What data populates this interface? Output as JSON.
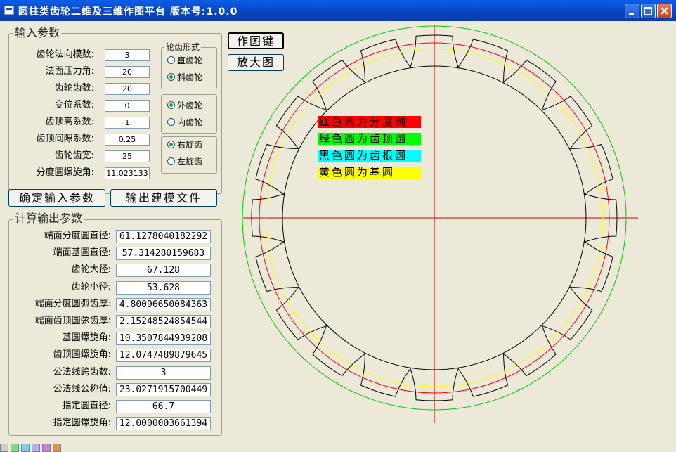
{
  "window": {
    "title": "圆柱类齿轮二维及三维作图平台 版本号:1.0.0"
  },
  "input_group": {
    "title": "输入参数",
    "fields": [
      {
        "label": "齿轮法向模数:",
        "value": "3"
      },
      {
        "label": "法面压力角:",
        "value": "20"
      },
      {
        "label": "齿轮齿数:",
        "value": "20"
      },
      {
        "label": "变位系数:",
        "value": "0"
      },
      {
        "label": "齿顶高系数:",
        "value": "1"
      },
      {
        "label": "齿顶间隙系数:",
        "value": "0.25"
      },
      {
        "label": "齿轮齿宽:",
        "value": "25"
      },
      {
        "label": "分度圆螺旋角:",
        "value": "11.023133"
      }
    ],
    "gear_type": {
      "title": "轮齿形式",
      "options": [
        "直齿轮",
        "斜齿轮"
      ],
      "selected": 1
    },
    "mesh_type": {
      "options": [
        "外齿轮",
        "内齿轮"
      ],
      "selected": 0
    },
    "hand_type": {
      "options": [
        "右旋齿",
        "左旋齿"
      ],
      "selected": 0
    }
  },
  "buttons": {
    "confirm": "确定输入参数",
    "export": "输出建模文件",
    "draw": "作图键",
    "zoom": "放大图"
  },
  "output_group": {
    "title": "计算输出参数",
    "fields": [
      {
        "label": "端面分度圆直径:",
        "value": "61.1278040182292"
      },
      {
        "label": "端面基圆直径:",
        "value": "57.314280159683"
      },
      {
        "label": "齿轮大径:",
        "value": "67.128"
      },
      {
        "label": "齿轮小径:",
        "value": "53.628"
      },
      {
        "label": "端面分度圆弧齿厚:",
        "value": "4.80096650084363"
      },
      {
        "label": "端面齿顶圆弦齿厚:",
        "value": "2.15248524854544"
      },
      {
        "label": "基圆螺旋角:",
        "value": "10.3507844939208"
      },
      {
        "label": "齿顶圆螺旋角:",
        "value": "12.0747489879645"
      },
      {
        "label": "公法线跨齿数:",
        "value": "3"
      },
      {
        "label": "公法线公称值:",
        "value": "23.0271915700449"
      },
      {
        "label": "指定圆直径:",
        "value": "66.7"
      },
      {
        "label": "指定圆螺旋角:",
        "value": "12.0000003661394"
      }
    ]
  },
  "drawing_legend": [
    {
      "text": "红色圆为分度圆",
      "color": "#ff0000"
    },
    {
      "text": "绿色圆为齿顶圆",
      "color": "#00ff00"
    },
    {
      "text": "黑色圆为齿根圆",
      "color": "#00ffff"
    },
    {
      "text": "黄色圆为基圆",
      "color": "#ffff00"
    }
  ],
  "gear": {
    "teeth": 20,
    "colors": {
      "pitch": "#ff0000",
      "tip": "#00cc00",
      "root": "#000000",
      "base": "#ffff00",
      "axis": "#cc0000"
    }
  }
}
